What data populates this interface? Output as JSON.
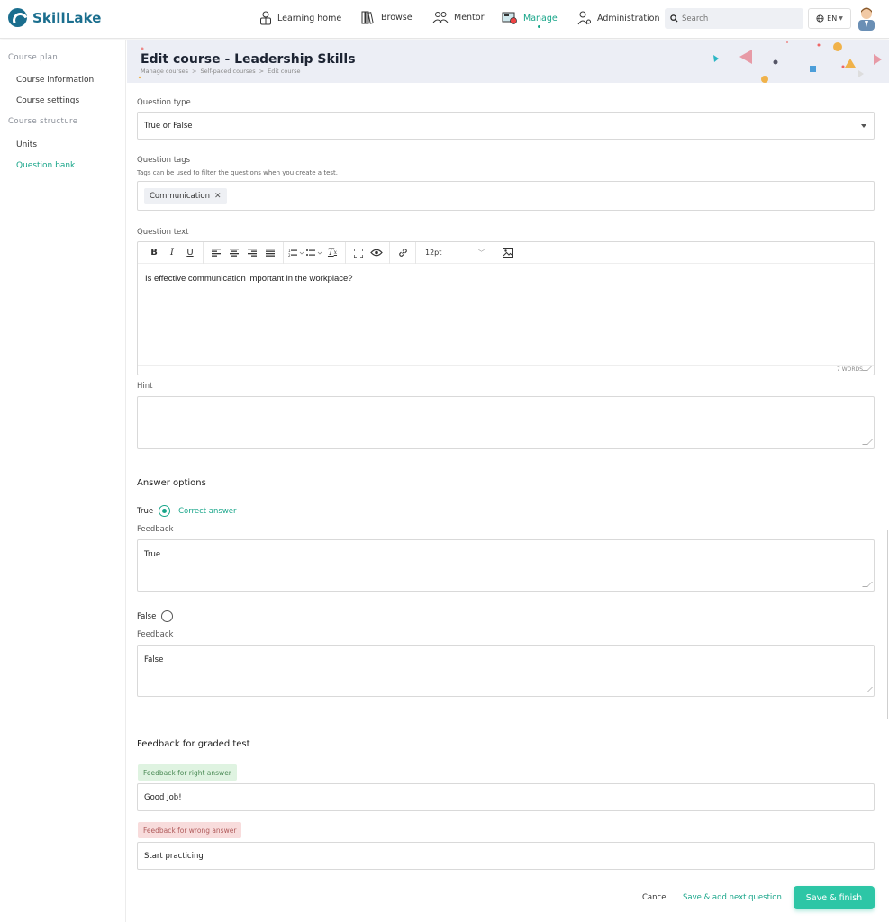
{
  "app": {
    "name": "SkillLake"
  },
  "nav": {
    "items": [
      {
        "label": "Learning home",
        "icon": "learning-home-icon"
      },
      {
        "label": "Browse",
        "icon": "books-icon"
      },
      {
        "label": "Mentor",
        "icon": "mentor-icon"
      },
      {
        "label": "Manage",
        "icon": "manage-icon",
        "active": true
      },
      {
        "label": "Administration",
        "icon": "administration-icon"
      }
    ],
    "search_placeholder": "Search",
    "language": "EN"
  },
  "sidebar": {
    "sections": [
      {
        "title": "Course plan",
        "items": [
          "Course information",
          "Course settings"
        ]
      },
      {
        "title": "Course structure",
        "items": [
          "Units",
          "Question bank"
        ]
      }
    ],
    "active_item": "Question bank"
  },
  "header": {
    "title": "Edit course - Leadership Skills",
    "breadcrumb": [
      "Manage courses",
      "Self-paced courses",
      "Edit course"
    ]
  },
  "form": {
    "question_type": {
      "label": "Question type",
      "value": "True or False"
    },
    "question_tags": {
      "label": "Question tags",
      "help": "Tags can be used to filter the questions when you create a test.",
      "tags": [
        "Communication"
      ]
    },
    "question_text": {
      "label": "Question text",
      "font_size": "12pt",
      "content": "Is effective communication important in the workplace?",
      "word_count": "7 WORDS"
    },
    "hint": {
      "label": "Hint",
      "value": ""
    },
    "answer_options": {
      "title": "Answer options",
      "correct_label": "Correct answer",
      "feedback_label": "Feedback",
      "options": [
        {
          "label": "True",
          "feedback": "True",
          "correct": true
        },
        {
          "label": "False",
          "feedback": "False",
          "correct": false
        }
      ]
    },
    "graded_feedback": {
      "title": "Feedback for graded test",
      "right_label": "Feedback for right answer",
      "right_value": "Good Job!",
      "wrong_label": "Feedback for wrong answer",
      "wrong_value": "Start practicing"
    }
  },
  "actions": {
    "cancel": "Cancel",
    "save_next": "Save & add next question",
    "save_finish": "Save & finish"
  },
  "colors": {
    "accent": "#17a589",
    "brand": "#1a6e8e",
    "primary_button": "#2dc6a6"
  }
}
